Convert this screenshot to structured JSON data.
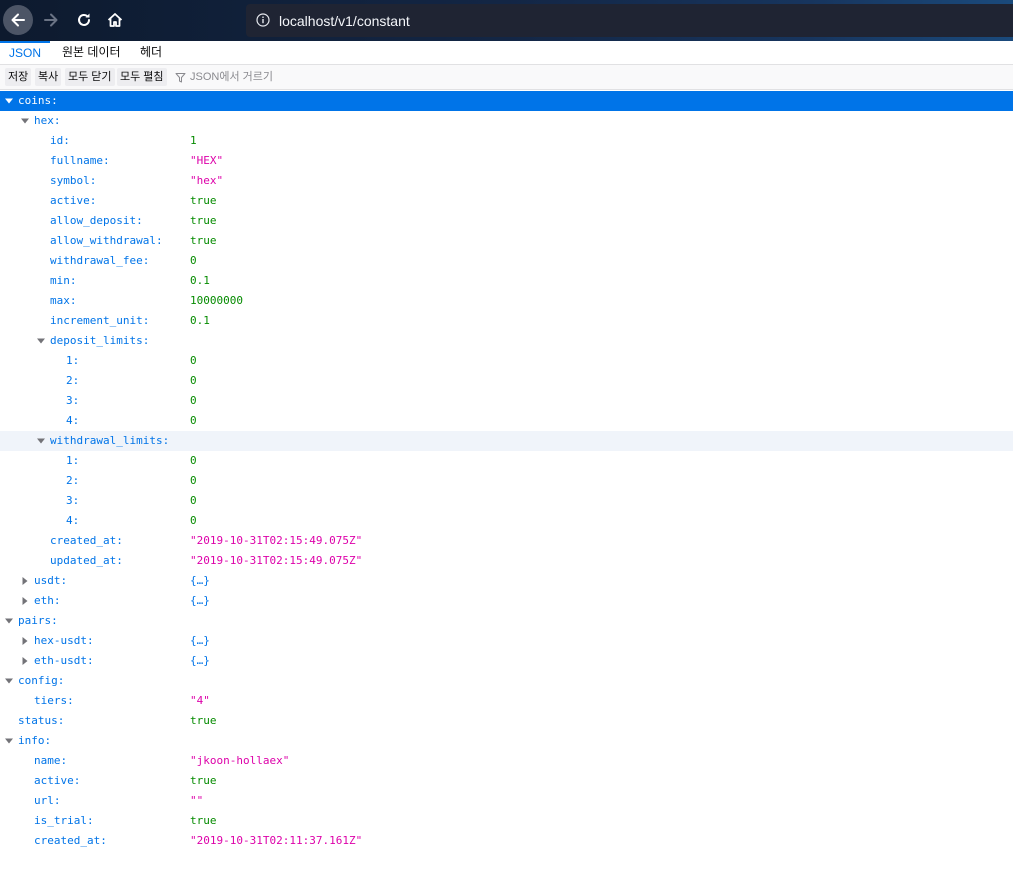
{
  "browser": {
    "url": "localhost/v1/constant"
  },
  "tabs": [
    {
      "label": "JSON",
      "selected": true
    },
    {
      "label": "원본 데이터",
      "selected": false
    },
    {
      "label": "헤더",
      "selected": false
    }
  ],
  "toolbar": {
    "save": "저장",
    "copy": "복사",
    "collapse_all": "모두 닫기",
    "expand_all": "모두 펼침",
    "filter_placeholder": "JSON에서 거르기"
  },
  "tree": [
    {
      "key": "coins:",
      "indent": 0,
      "twisty": "open",
      "selected": true
    },
    {
      "key": "hex:",
      "indent": 1,
      "twisty": "open"
    },
    {
      "key": "id:",
      "indent": 2,
      "value": "1",
      "type": "num"
    },
    {
      "key": "fullname:",
      "indent": 2,
      "value": "\"HEX\"",
      "type": "str"
    },
    {
      "key": "symbol:",
      "indent": 2,
      "value": "\"hex\"",
      "type": "str"
    },
    {
      "key": "active:",
      "indent": 2,
      "value": "true",
      "type": "bool"
    },
    {
      "key": "allow_deposit:",
      "indent": 2,
      "value": "true",
      "type": "bool"
    },
    {
      "key": "allow_withdrawal:",
      "indent": 2,
      "value": "true",
      "type": "bool"
    },
    {
      "key": "withdrawal_fee:",
      "indent": 2,
      "value": "0",
      "type": "num"
    },
    {
      "key": "min:",
      "indent": 2,
      "value": "0.1",
      "type": "num"
    },
    {
      "key": "max:",
      "indent": 2,
      "value": "10000000",
      "type": "num"
    },
    {
      "key": "increment_unit:",
      "indent": 2,
      "value": "0.1",
      "type": "num"
    },
    {
      "key": "deposit_limits:",
      "indent": 2,
      "twisty": "open"
    },
    {
      "key": "1:",
      "indent": 3,
      "value": "0",
      "type": "num"
    },
    {
      "key": "2:",
      "indent": 3,
      "value": "0",
      "type": "num"
    },
    {
      "key": "3:",
      "indent": 3,
      "value": "0",
      "type": "num"
    },
    {
      "key": "4:",
      "indent": 3,
      "value": "0",
      "type": "num"
    },
    {
      "key": "withdrawal_limits:",
      "indent": 2,
      "twisty": "open",
      "hover": true
    },
    {
      "key": "1:",
      "indent": 3,
      "value": "0",
      "type": "num"
    },
    {
      "key": "2:",
      "indent": 3,
      "value": "0",
      "type": "num"
    },
    {
      "key": "3:",
      "indent": 3,
      "value": "0",
      "type": "num"
    },
    {
      "key": "4:",
      "indent": 3,
      "value": "0",
      "type": "num"
    },
    {
      "key": "created_at:",
      "indent": 2,
      "value": "\"2019-10-31T02:15:49.075Z\"",
      "type": "str"
    },
    {
      "key": "updated_at:",
      "indent": 2,
      "value": "\"2019-10-31T02:15:49.075Z\"",
      "type": "str"
    },
    {
      "key": "usdt:",
      "indent": 1,
      "twisty": "closed",
      "value": "{…}",
      "type": "obj"
    },
    {
      "key": "eth:",
      "indent": 1,
      "twisty": "closed",
      "value": "{…}",
      "type": "obj"
    },
    {
      "key": "pairs:",
      "indent": 0,
      "twisty": "open"
    },
    {
      "key": "hex-usdt:",
      "indent": 1,
      "twisty": "closed",
      "value": "{…}",
      "type": "obj"
    },
    {
      "key": "eth-usdt:",
      "indent": 1,
      "twisty": "closed",
      "value": "{…}",
      "type": "obj"
    },
    {
      "key": "config:",
      "indent": 0,
      "twisty": "open"
    },
    {
      "key": "tiers:",
      "indent": 1,
      "value": "\"4\"",
      "type": "str"
    },
    {
      "key": "status:",
      "indent": 0,
      "value": "true",
      "type": "bool"
    },
    {
      "key": "info:",
      "indent": 0,
      "twisty": "open"
    },
    {
      "key": "name:",
      "indent": 1,
      "value": "\"jkoon-hollaex\"",
      "type": "str"
    },
    {
      "key": "active:",
      "indent": 1,
      "value": "true",
      "type": "bool"
    },
    {
      "key": "url:",
      "indent": 1,
      "value": "\"\"",
      "type": "str"
    },
    {
      "key": "is_trial:",
      "indent": 1,
      "value": "true",
      "type": "bool"
    },
    {
      "key": "created_at:",
      "indent": 1,
      "value": "\"2019-10-31T02:11:37.161Z\"",
      "type": "str"
    }
  ]
}
